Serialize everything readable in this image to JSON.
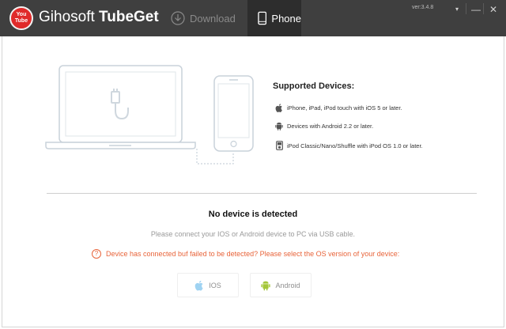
{
  "app": {
    "logo_text": "You\nTube",
    "brand_light": "Gihosoft ",
    "brand_bold": "TubeGet",
    "version": "ver:3.4.8"
  },
  "tabs": [
    {
      "label": "Download",
      "icon": "download-icon",
      "active": false
    },
    {
      "label": "Phone",
      "icon": "phone-icon",
      "active": true
    }
  ],
  "window_controls": {
    "menu": "▾",
    "minimize": "—",
    "close": "✕"
  },
  "supported": {
    "title": "Supported Devices:",
    "devices": [
      {
        "icon": "apple-icon",
        "text": "iPhone, iPad, iPod touch with iOS 5 or later."
      },
      {
        "icon": "android-icon",
        "text": "Devices with Android 2.2 or later."
      },
      {
        "icon": "ipod-icon",
        "text": "iPod Classic/Nano/Shuffle with iPod OS 1.0 or later."
      }
    ]
  },
  "status": {
    "title": "No device is detected",
    "hint": "Please connect your IOS or Android device to PC via USB cable.",
    "warning_icon": "?",
    "warning": "Device has connected buf failed to be detected? Please select the OS version of your device:"
  },
  "os_buttons": {
    "ios": "IOS",
    "android": "Android"
  },
  "colors": {
    "titlebar": "#3f3f3f",
    "active_tab": "#2d2d2d",
    "warning": "#e8643a",
    "android": "#a4c639",
    "ios": "#9fd3f2"
  }
}
